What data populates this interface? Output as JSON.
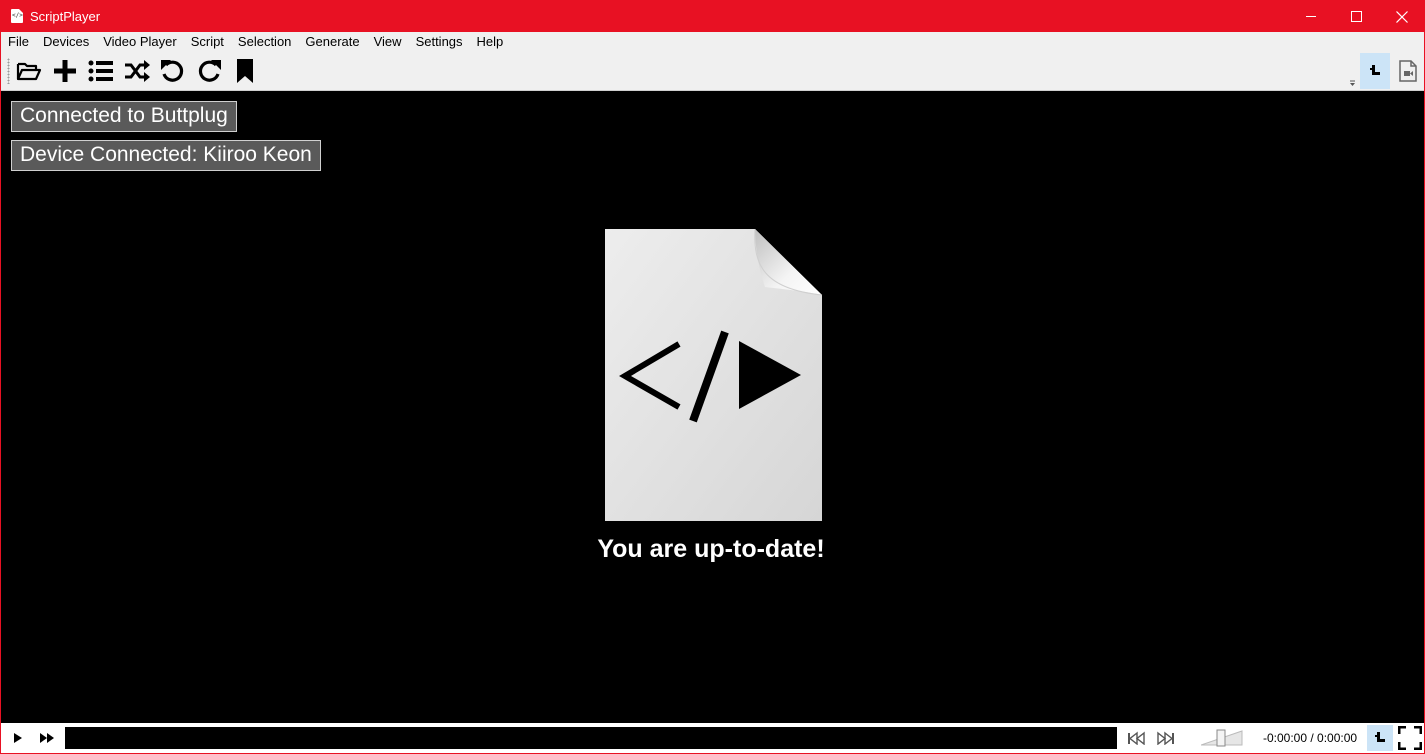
{
  "window": {
    "title": "ScriptPlayer",
    "app_icon_glyph": "</>",
    "accent_color": "#e81123"
  },
  "menu": {
    "items": [
      "File",
      "Devices",
      "Video Player",
      "Script",
      "Selection",
      "Generate",
      "View",
      "Settings",
      "Help"
    ]
  },
  "toolbar": {
    "buttons": [
      "open-folder-icon",
      "add-icon",
      "playlist-icon",
      "shuffle-icon",
      "rotate-left-icon",
      "rotate-right-icon",
      "bookmark-icon"
    ],
    "right_buttons": [
      "device-icon",
      "script-file-icon"
    ]
  },
  "status": {
    "buttplug": "Connected to Buttplug",
    "device": "Device Connected: Kiiroo Keon"
  },
  "main": {
    "logo_glyph": "</>▶",
    "message": "You are up-to-date!"
  },
  "controls": {
    "time": "-0:00:00 / 0:00:00",
    "buttons": [
      "play-icon",
      "fast-forward-icon",
      "previous-icon",
      "next-icon",
      "volume-slider",
      "device-icon",
      "fullscreen-icon"
    ]
  }
}
